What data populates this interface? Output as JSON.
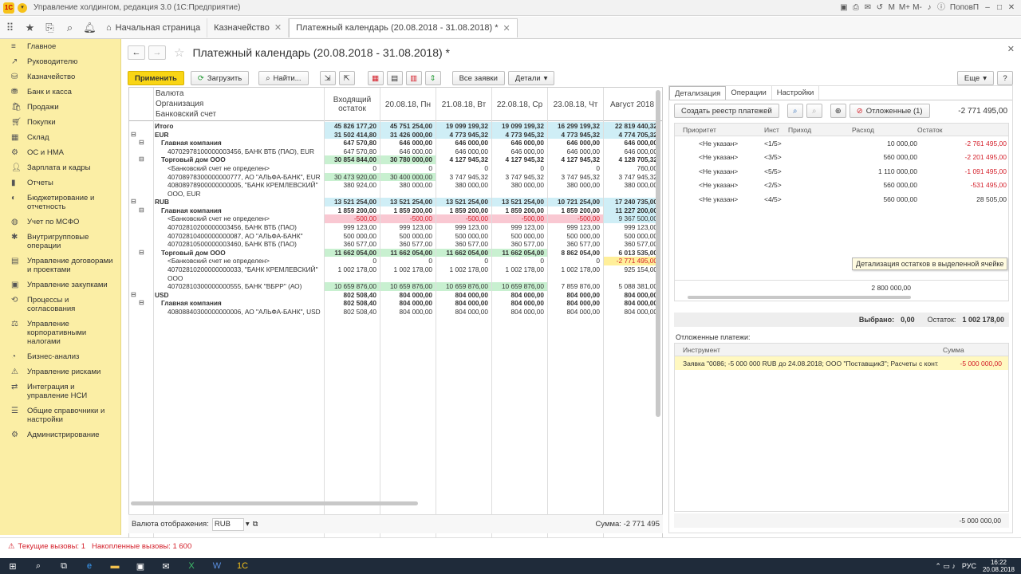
{
  "window": {
    "title": "Управление холдингом, редакция 3.0 (1С:Предприятие)",
    "user": "ПоповП"
  },
  "tabs": [
    "Начальная страница",
    "Казначейство",
    "Платежный календарь (20.08.2018 - 31.08.2018) *"
  ],
  "sidebar": [
    "Главное",
    "Руководителю",
    "Казначейство",
    "Банк и касса",
    "Продажи",
    "Покупки",
    "Склад",
    "ОС и НМА",
    "Зарплата и кадры",
    "Отчеты",
    "Бюджетирование и отчетность",
    "Учет по МСФО",
    "Внутригрупповые операции",
    "Управление договорами и проектами",
    "Управление закупками",
    "Процессы и согласования",
    "Управление корпоративными налогами",
    "Бизнес-анализ",
    "Управление рисками",
    "Интеграция и управление НСИ",
    "Общие справочники и настройки",
    "Администрирование"
  ],
  "page": {
    "title": "Платежный календарь (20.08.2018 - 31.08.2018) *",
    "more": "Еще",
    "help": "?"
  },
  "toolbar": {
    "apply": "Применить",
    "load": "Загрузить",
    "find": "Найти...",
    "all_requests": "Все заявки",
    "details": "Детали"
  },
  "grid": {
    "head_left": [
      "Валюта",
      "Организация",
      "Банковский счет"
    ],
    "head_cols": [
      "Входящий остаток",
      "20.08.18, Пн",
      "21.08.18, Вт",
      "22.08.18, Ср",
      "23.08.18, Чт",
      "Август 2018"
    ],
    "rows": [
      {
        "l": "Итого",
        "lv": 0,
        "b": 1,
        "tg": "",
        "v": [
          "45 826 177,20",
          "45 751 254,00",
          "19 099 199,32",
          "19 099 199,32",
          "16 299 199,32",
          "22 819 440,32"
        ],
        "bg": [
          "b",
          "b",
          "b",
          "b",
          "b",
          "b"
        ]
      },
      {
        "l": "EUR",
        "lv": 0,
        "b": 1,
        "tg": "⊟",
        "v": [
          "31 502 414,80",
          "31 426 000,00",
          "4 773 945,32",
          "4 773 945,32",
          "4 773 945,32",
          "4 774 705,32"
        ],
        "bg": [
          "b",
          "b",
          "b",
          "b",
          "b",
          "b"
        ]
      },
      {
        "l": "Главная компания",
        "lv": 1,
        "b": 1,
        "tg": "⊟",
        "v": [
          "647 570,80",
          "646 000,00",
          "646 000,00",
          "646 000,00",
          "646 000,00",
          "646 000,00"
        ],
        "bg": [
          "",
          "",
          "",
          "",
          "",
          ""
        ]
      },
      {
        "l": "40702978100000003456, БАНК ВТБ (ПАО), EUR",
        "lv": 2,
        "b": 0,
        "tg": "",
        "v": [
          "647 570,80",
          "646 000,00",
          "646 000,00",
          "646 000,00",
          "646 000,00",
          "646 000,00"
        ],
        "bg": [
          "",
          "",
          "",
          "",
          "",
          ""
        ]
      },
      {
        "l": "Торговый дом ООО",
        "lv": 1,
        "b": 1,
        "tg": "⊟",
        "v": [
          "30 854 844,00",
          "30 780 000,00",
          "4 127 945,32",
          "4 127 945,32",
          "4 127 945,32",
          "4 128 705,32"
        ],
        "bg": [
          "g",
          "g",
          "",
          "",
          "",
          ""
        ]
      },
      {
        "l": "<Банковский счет не определен>",
        "lv": 2,
        "b": 0,
        "tg": "",
        "v": [
          "0",
          "0",
          "0",
          "0",
          "0",
          "760,00"
        ],
        "bg": [
          "",
          "",
          "",
          "",
          "",
          ""
        ]
      },
      {
        "l": "40708978300000000777, АО \"АЛЬФА-БАНК\", EUR",
        "lv": 2,
        "b": 0,
        "tg": "",
        "v": [
          "30 473 920,00",
          "30 400 000,00",
          "3 747 945,32",
          "3 747 945,32",
          "3 747 945,32",
          "3 747 945,32"
        ],
        "bg": [
          "g",
          "g",
          "",
          "",
          "",
          ""
        ]
      },
      {
        "l": "40808978900000000005, \"БАНК КРЕМЛЕВСКИЙ\"",
        "l2": "ООО, EUR",
        "lv": 2,
        "b": 0,
        "tg": "",
        "v": [
          "380 924,00",
          "380 000,00",
          "380 000,00",
          "380 000,00",
          "380 000,00",
          "380 000,00"
        ],
        "bg": [
          "",
          "",
          "",
          "",
          "",
          ""
        ],
        "h2": 1
      },
      {
        "l": "RUB",
        "lv": 0,
        "b": 1,
        "tg": "⊟",
        "v": [
          "13 521 254,00",
          "13 521 254,00",
          "13 521 254,00",
          "13 521 254,00",
          "10 721 254,00",
          "17 240 735,00"
        ],
        "bg": [
          "b",
          "b",
          "b",
          "b",
          "b",
          "b"
        ]
      },
      {
        "l": "Главная компания",
        "lv": 1,
        "b": 1,
        "tg": "⊟",
        "v": [
          "1 859 200,00",
          "1 859 200,00",
          "1 859 200,00",
          "1 859 200,00",
          "1 859 200,00",
          "11 227 200,00"
        ],
        "bg": [
          "",
          "",
          "",
          "",
          "",
          "b"
        ]
      },
      {
        "l": "<Банковский счет не определен>",
        "lv": 2,
        "b": 0,
        "tg": "",
        "v": [
          "-500,00",
          "-500,00",
          "-500,00",
          "-500,00",
          "-500,00",
          "9 367 500,00"
        ],
        "bg": [
          "p",
          "p",
          "p",
          "p",
          "p",
          "b"
        ],
        "neg": 1
      },
      {
        "l": "40702810200000003456, БАНК ВТБ (ПАО)",
        "lv": 2,
        "b": 0,
        "tg": "",
        "v": [
          "999 123,00",
          "999 123,00",
          "999 123,00",
          "999 123,00",
          "999 123,00",
          "999 123,00"
        ],
        "bg": [
          "",
          "",
          "",
          "",
          "",
          ""
        ]
      },
      {
        "l": "40702810400000000087, АО \"АЛЬФА-БАНК\"",
        "lv": 2,
        "b": 0,
        "tg": "",
        "v": [
          "500 000,00",
          "500 000,00",
          "500 000,00",
          "500 000,00",
          "500 000,00",
          "500 000,00"
        ],
        "bg": [
          "",
          "",
          "",
          "",
          "",
          ""
        ]
      },
      {
        "l": "40702810500000003460, БАНК ВТБ (ПАО)",
        "lv": 2,
        "b": 0,
        "tg": "",
        "v": [
          "360 577,00",
          "360 577,00",
          "360 577,00",
          "360 577,00",
          "360 577,00",
          "360 577,00"
        ],
        "bg": [
          "",
          "",
          "",
          "",
          "",
          ""
        ]
      },
      {
        "l": "Торговый дом ООО",
        "lv": 1,
        "b": 1,
        "tg": "⊟",
        "v": [
          "11 662 054,00",
          "11 662 054,00",
          "11 662 054,00",
          "11 662 054,00",
          "8 862 054,00",
          "6 013 535,00"
        ],
        "bg": [
          "g",
          "g",
          "g",
          "g",
          "",
          ""
        ]
      },
      {
        "l": "<Банковский счет не определен>",
        "lv": 2,
        "b": 0,
        "tg": "",
        "v": [
          "0",
          "0",
          "0",
          "0",
          "0",
          "-2 771 495,00"
        ],
        "bg": [
          "",
          "",
          "",
          "",
          "",
          "y"
        ]
      },
      {
        "l": "40702810200000000033, \"БАНК КРЕМЛЕВСКИЙ\"",
        "l2": "ООО",
        "lv": 2,
        "b": 0,
        "tg": "",
        "v": [
          "1 002 178,00",
          "1 002 178,00",
          "1 002 178,00",
          "1 002 178,00",
          "1 002 178,00",
          "925 154,00"
        ],
        "bg": [
          "",
          "",
          "",
          "",
          "",
          ""
        ],
        "h2": 1
      },
      {
        "l": "40702810300000000555, БАНК \"ВБРР\" (АО)",
        "lv": 2,
        "b": 0,
        "tg": "",
        "v": [
          "10 659 876,00",
          "10 659 876,00",
          "10 659 876,00",
          "10 659 876,00",
          "7 859 876,00",
          "5 088 381,00"
        ],
        "bg": [
          "g",
          "g",
          "g",
          "g",
          "",
          ""
        ]
      },
      {
        "l": "USD",
        "lv": 0,
        "b": 1,
        "tg": "⊟",
        "v": [
          "802 508,40",
          "804 000,00",
          "804 000,00",
          "804 000,00",
          "804 000,00",
          "804 000,00"
        ],
        "bg": [
          "",
          "",
          "",
          "",
          "",
          ""
        ]
      },
      {
        "l": "Главная компания",
        "lv": 1,
        "b": 1,
        "tg": "⊟",
        "v": [
          "802 508,40",
          "804 000,00",
          "804 000,00",
          "804 000,00",
          "804 000,00",
          "804 000,00"
        ],
        "bg": [
          "",
          "",
          "",
          "",
          "",
          ""
        ]
      },
      {
        "l": "40808840300000000006, АО \"АЛЬФА-БАНК\", USD",
        "lv": 2,
        "b": 0,
        "tg": "",
        "v": [
          "802 508,40",
          "804 000,00",
          "804 000,00",
          "804 000,00",
          "804 000,00",
          "804 000,00"
        ],
        "bg": [
          "",
          "",
          "",
          "",
          "",
          ""
        ]
      }
    ],
    "footer_label": "Валюта отображения:",
    "footer_currency": "RUB",
    "footer_sum": "Сумма: -2 771 495"
  },
  "right": {
    "tabs": [
      "Детализация",
      "Операции",
      "Настройки"
    ],
    "create_btn": "Создать реестр платежей",
    "deferred_btn": "Отложенные (1)",
    "total": "-2 771 495,00",
    "cols": [
      "Приоритет",
      "Инст",
      "Приход",
      "Расход",
      "Остаток"
    ],
    "rows": [
      {
        "p": "<Не указан>",
        "i": "<1/5>",
        "r": "10 000,00",
        "o": "-2 761 495,00",
        "neg": 1
      },
      {
        "p": "<Не указан>",
        "i": "<3/5>",
        "r": "560 000,00",
        "o": "-2 201 495,00",
        "neg": 1
      },
      {
        "p": "<Не указан>",
        "i": "<5/5>",
        "r": "1 110 000,00",
        "o": "-1 091 495,00",
        "neg": 1
      },
      {
        "p": "<Не указан>",
        "i": "<2/5>",
        "r": "560 000,00",
        "o": "-531 495,00",
        "neg": 1
      },
      {
        "p": "<Не указан>",
        "i": "<4/5>",
        "r": "560 000,00",
        "o": "28 505,00",
        "neg": 0
      }
    ],
    "sum_rash": "2 800 000,00",
    "selected_lbl": "Выбрано:",
    "selected_val": "0,00",
    "balance_lbl": "Остаток:",
    "balance_val": "1 002 178,00",
    "deferred_title": "Отложенные платежи:",
    "deferred_cols": [
      "Инструмент",
      "Сумма"
    ],
    "deferred_row": {
      "t": "Заявка \"0086; -5 000 000 RUB до 24.08.2018; ООО \"Поставщик3\"; Расчеты с конт...",
      "s": "-5 000 000,00"
    },
    "deferred_total": "-5 000 000,00",
    "tooltip": "Детализация остатков в выделенной ячейке"
  },
  "status": {
    "current": "Текущие вызовы: 1",
    "accum": "Накопленные вызовы: 1 600"
  },
  "taskbar": {
    "lang": "РУС",
    "time": "16:22",
    "date": "20.08.2018"
  }
}
